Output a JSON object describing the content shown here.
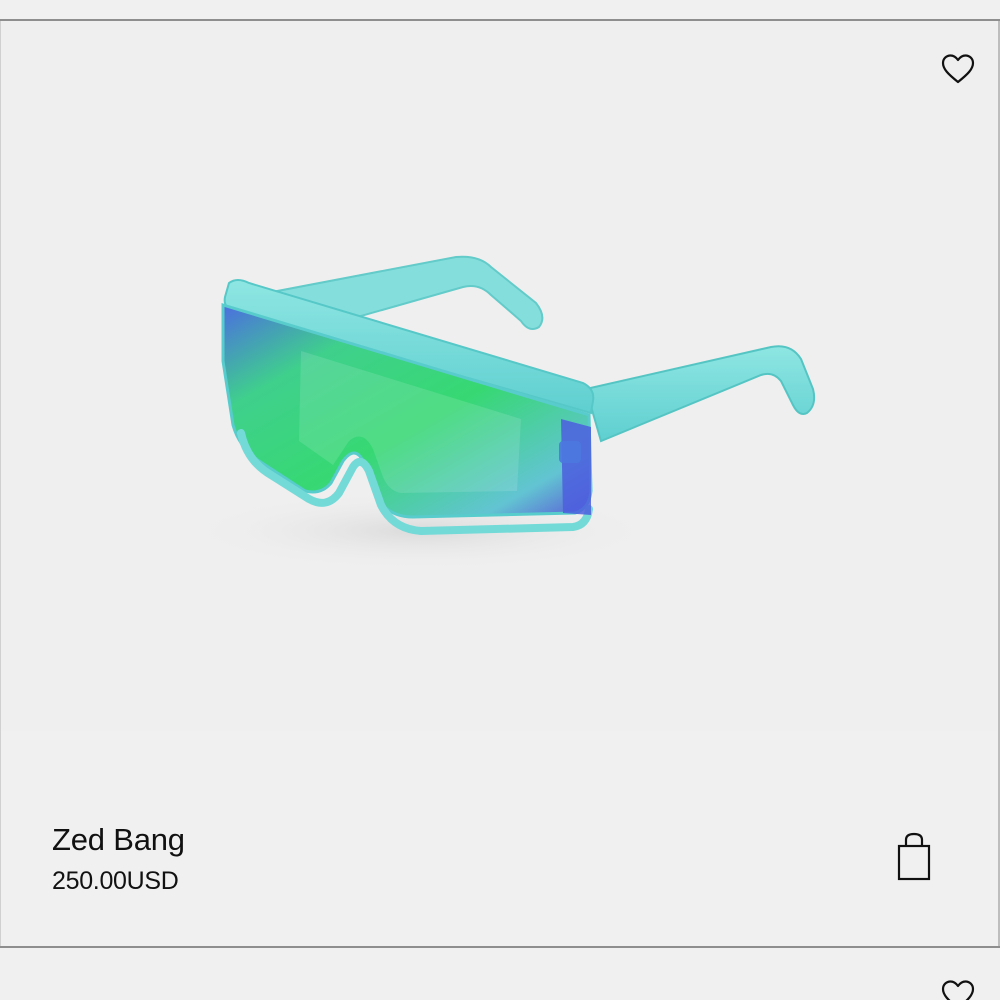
{
  "product": {
    "name": "Zed Bang",
    "price": "250.00USD",
    "image_alt": "Zed Bang sunglasses, turquoise frame with green mirror lens"
  },
  "icons": {
    "wishlist": "heart-outline-icon",
    "add_to_bag": "shopping-bag-icon"
  },
  "colors": {
    "background": "#f0f0f0",
    "frame": "#6fd8d6",
    "lens": "#3ed27a",
    "lens_edge": "#4a5fd8",
    "text": "#111111",
    "divider": "#8e8e8e"
  }
}
